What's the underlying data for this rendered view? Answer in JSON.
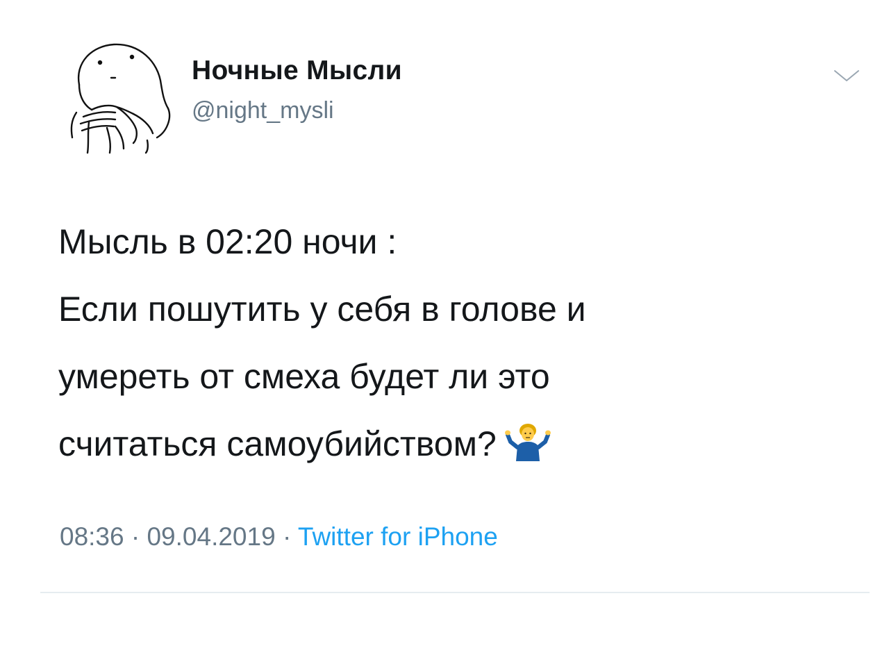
{
  "author": {
    "display_name": "Ночные Мысли",
    "handle": "@night_mysli",
    "avatar_icon": "doodle-face-avatar-icon"
  },
  "menu": {
    "icon": "chevron-down-icon"
  },
  "tweet": {
    "lines": [
      "Мысль в 02:20 ночи :",
      "Если пошутить у себя в голове и",
      "умереть от смеха будет ли это",
      "считаться самоубийством?"
    ],
    "emoji": "shrugging-person-emoji-icon"
  },
  "meta": {
    "time": "08:36",
    "separator": "·",
    "date": "09.04.2019",
    "source": "Twitter for iPhone"
  },
  "colors": {
    "text": "#14171a",
    "secondary": "#657786",
    "link": "#1da1f2",
    "divider": "#e6ecf0"
  }
}
